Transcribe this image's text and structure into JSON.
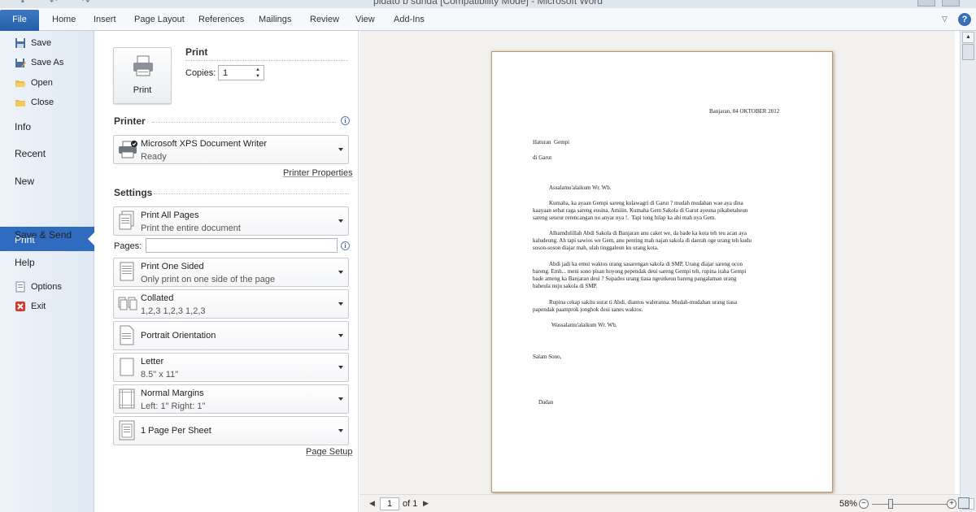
{
  "window": {
    "title": "pidato b sunda [Compatibility Mode] - Microsoft Word"
  },
  "ribbon": {
    "file_tab": "File",
    "tabs": [
      "Home",
      "Insert",
      "Page Layout",
      "References",
      "Mailings",
      "Review",
      "View",
      "Add-Ins"
    ]
  },
  "backstage": {
    "commands": [
      "Save",
      "Save As",
      "Open",
      "Close"
    ],
    "tabs": [
      "Info",
      "Recent",
      "New",
      "Print",
      "Save & Send",
      "Help"
    ],
    "bottom_commands": [
      "Options",
      "Exit"
    ]
  },
  "print_panel": {
    "print_button": "Print",
    "header": "Print",
    "copies_label": "Copies:",
    "copies_value": "1",
    "printer_header": "Printer",
    "printer_name": "Microsoft XPS Document Writer",
    "printer_status": "Ready",
    "printer_properties": "Printer Properties",
    "settings_header": "Settings",
    "pages_label": "Pages:",
    "pages_value": "",
    "page_setup": "Page Setup",
    "settings": [
      {
        "line1": "Print All Pages",
        "line2": "Print the entire document"
      },
      {
        "line1": "Print One Sided",
        "line2": "Only print on one side of the page"
      },
      {
        "line1": "Collated",
        "line2": "1,2,3    1,2,3    1,2,3"
      },
      {
        "line1": "Portrait Orientation",
        "line2": ""
      },
      {
        "line1": "Letter",
        "line2": "8.5\" x 11\""
      },
      {
        "line1": "Normal Margins",
        "line2": "Left:  1\"    Right:  1\""
      },
      {
        "line1": "1 Page Per Sheet",
        "line2": ""
      }
    ]
  },
  "document": {
    "date": "Banjaran, 04 OKTOBER 2012",
    "recipient": "Haturan  Gempi",
    "location": "di Garut",
    "greeting": "Assalamu'alaikum Wr. Wb.",
    "p1": [
      "Kumaha, ka ayaan Gempi sareng kulawagri di Garut ? mudah mudahan wae aya dina",
      "kaayaan sehat raga sareng eusina, Amiiin. Kumaha Gem Sakola di Garut ayeuna pikabetaheun",
      "sareng seueur rerencangan nu anyar nya !.  Tapi tong hilap ka abi mah nya Gem."
    ],
    "p2": [
      "Alhamdulillah Abdi Sakola di Banjaran anu caket we, da bade ka kota teh teu acan aya",
      "kaludeung. Ah tapi sawios we Gem, anu penting mah najan sakola di daerah oge urang teh kudu",
      "soson-soson diajar mah, ulah tinggaleun ku urang kota."
    ],
    "p3": [
      "Abdi jadi ka emut waktos urang sasarengan sakola di SMP, Urang diajar sareng ocon",
      "bareng. Emh... meni sono pisan hoyong pependak deui sareng Gempi teh, rupina iraha Gempi",
      "bade ameng ka Banjaran deui ? Supados urang tiasa ngeutkeun bareng pangalaman urang",
      "baheula nuju sakola di SMP."
    ],
    "p4": [
      "Rupina cekap sakitu surat ti Abdi, diantos waleranna. Mudah-mudahan urang tiasa",
      "papendak paamprok jonghok deui sanes waktos."
    ],
    "closing": "Wassalamu'alaikum Wr. Wb.",
    "salutation": "Salam Sono,",
    "signature": "Dadan"
  },
  "statusbar": {
    "page_current": "1",
    "page_total": "of 1",
    "zoom": "58%",
    "zoom_level_percent": 58
  },
  "colors": {
    "accent": "#2f6cc0",
    "file_tab": "#2a64ae",
    "preview_bg": "#f2f1ef",
    "page_border": "#b9986a"
  },
  "icons": [
    "save-icon",
    "save-as-icon",
    "open-folder-icon",
    "close-folder-icon",
    "options-icon",
    "exit-icon",
    "printer-icon",
    "info-icon",
    "pages-icon",
    "one-sided-icon",
    "collated-icon",
    "portrait-icon",
    "letter-icon",
    "margins-icon",
    "pages-per-sheet-icon"
  ]
}
